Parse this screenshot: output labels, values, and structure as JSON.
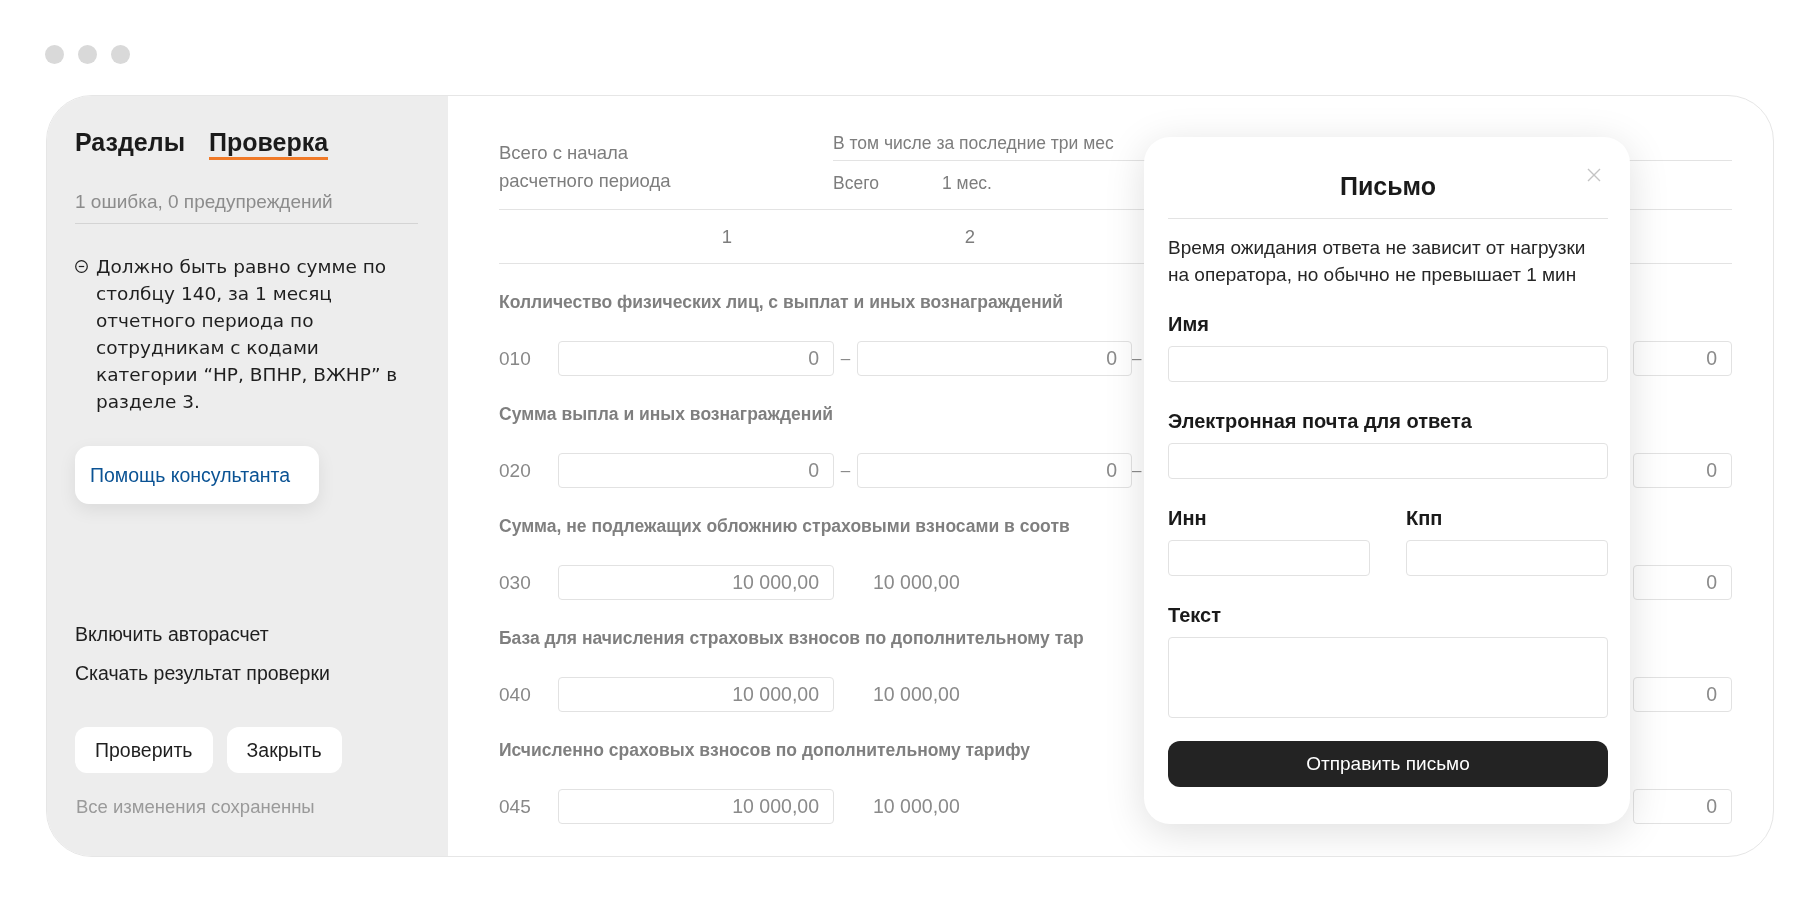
{
  "sidebar": {
    "tabs": [
      {
        "label": "Разделы",
        "selected": false
      },
      {
        "label": "Проверка",
        "selected": true
      }
    ],
    "summary": "1 ошибка, 0 предупреждений",
    "errors": [
      "Должно быть равно сумме по столбцу 140, за 1 месяц отчетного периода по сотрудникам с кодами категории “НР, ВПНР, ВЖНР” в разделе 3."
    ],
    "help_button": "Помощь консультанта",
    "links": [
      "Включить авторасчет",
      "Скачать результат проверки"
    ],
    "buttons": [
      "Проверить",
      "Закрыть"
    ],
    "save_status": "Все изменения сохраненны"
  },
  "form": {
    "header": {
      "column_1": "Всего с начала расчетного периода",
      "group": "В том числе за последние три мес",
      "subcolumns": [
        "Всего",
        "1 мес."
      ],
      "column_numbers": [
        "1",
        "2"
      ]
    },
    "sections": [
      {
        "label": "Колличество физических лиц, с выплат и иных вознаграждений",
        "code": "010",
        "cells": [
          {
            "kind": "input",
            "text": "0"
          },
          {
            "kind": "dash",
            "text": "–"
          },
          {
            "kind": "input",
            "text": "0"
          },
          {
            "kind": "dash",
            "text": "–"
          }
        ],
        "right_field": "0"
      },
      {
        "label": "Сумма выпла и иных вознаграждений",
        "code": "020",
        "cells": [
          {
            "kind": "input",
            "text": "0"
          },
          {
            "kind": "dash",
            "text": "–"
          },
          {
            "kind": "input",
            "text": "0"
          },
          {
            "kind": "dash",
            "text": "–"
          }
        ],
        "right_field": "0"
      },
      {
        "label": "Сумма, не подлежащих обложнию страховыми взносами в соотв",
        "code": "030",
        "cells": [
          {
            "kind": "input",
            "text": "10 000,00"
          },
          {
            "kind": "value",
            "text": "10 000,00"
          }
        ],
        "right_field": "0"
      },
      {
        "label": "База для начисления страховых взносов по дополнительному тар",
        "code": "040",
        "cells": [
          {
            "kind": "input",
            "text": "10 000,00"
          },
          {
            "kind": "value",
            "text": "10 000,00"
          }
        ],
        "right_field": "0"
      },
      {
        "label": "Исчисленно сраховых взносов по дополнительному тарифу",
        "code": "045",
        "cells": [
          {
            "kind": "input",
            "text": "10 000,00"
          },
          {
            "kind": "value",
            "text": "10 000,00"
          }
        ],
        "right_field": "0"
      }
    ]
  },
  "dialog": {
    "title": "Письмо",
    "note": "Время ожидания ответа не зависит от нагрузки на оператора, но обычно не превышает 1 мин",
    "fields": [
      {
        "label": "Имя",
        "kind": "text"
      },
      {
        "label": "Электронная почта для ответа",
        "kind": "text"
      },
      {
        "label": "Инн",
        "kind": "half"
      },
      {
        "label": "Кпп",
        "kind": "half"
      },
      {
        "label": "Текст",
        "kind": "textarea"
      }
    ],
    "submit": "Отправить письмо"
  }
}
